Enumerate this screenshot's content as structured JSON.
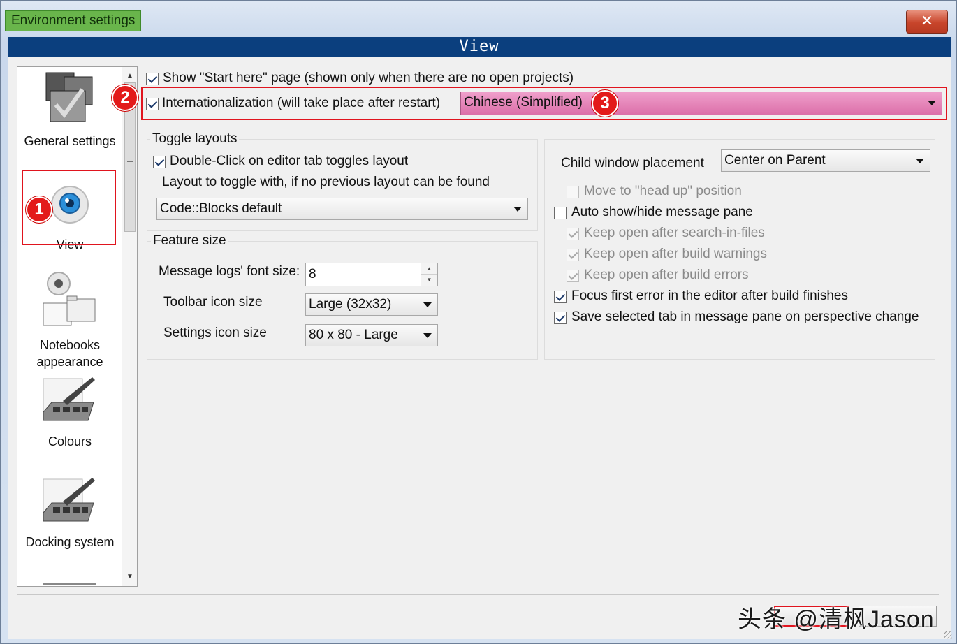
{
  "window": {
    "title": "Environment settings",
    "close_label": "✕"
  },
  "header": {
    "title": "View"
  },
  "sidebar": {
    "items": [
      {
        "label": "General settings",
        "icon": "checkbox-cube-icon"
      },
      {
        "label": "View",
        "icon": "eye-icon",
        "selected": true
      },
      {
        "label": "Notebooks appearance",
        "icon": "notebooks-icon"
      },
      {
        "label": "Colours",
        "icon": "palette-brush-icon"
      },
      {
        "label": "Docking system",
        "icon": "palette-brush-icon"
      }
    ]
  },
  "annotations": {
    "badge1": "1",
    "badge2": "2",
    "badge3": "3"
  },
  "top_options": {
    "show_start_here": {
      "label": "Show \"Start here\" page (shown only when there are no open projects)",
      "checked": true
    },
    "internationalization": {
      "label": "Internationalization (will take place after restart)",
      "checked": true
    },
    "language": {
      "value": "Chinese (Simplified)"
    }
  },
  "toggle_layouts": {
    "title": "Toggle layouts",
    "double_click": {
      "label": "Double-Click on editor tab toggles layout",
      "checked": true
    },
    "layout_hint": "Layout to toggle with, if no previous layout can be found",
    "layout_value": "Code::Blocks default"
  },
  "feature_size": {
    "title": "Feature size",
    "font_label": "Message logs' font size:",
    "font_value": "8",
    "toolbar_label": "Toolbar icon size",
    "toolbar_value": "Large (32x32)",
    "settings_label": "Settings icon size",
    "settings_value": "80 x 80 - Large"
  },
  "right_panel": {
    "placement_label": "Child window placement",
    "placement_value": "Center on Parent",
    "move_head_up": {
      "label": "Move to \"head up\" position",
      "checked": false,
      "enabled": false
    },
    "auto_show": {
      "label": "Auto show/hide message pane",
      "checked": false
    },
    "keep_search": {
      "label": "Keep open after search-in-files",
      "checked": true,
      "enabled": false
    },
    "keep_warnings": {
      "label": "Keep open after build warnings",
      "checked": true,
      "enabled": false
    },
    "keep_errors": {
      "label": "Keep open after build errors",
      "checked": true,
      "enabled": false
    },
    "focus_error": {
      "label": "Focus first error in the editor after build finishes",
      "checked": true
    },
    "save_tab": {
      "label": "Save selected tab in message pane on perspective change",
      "checked": true
    }
  },
  "watermark": "头条 @清枫Jason",
  "colors": {
    "header_bg": "#0b3f7e",
    "highlight": "#e0141e",
    "language_bg": "#e27fb4",
    "title_chip": "#69b54b"
  }
}
